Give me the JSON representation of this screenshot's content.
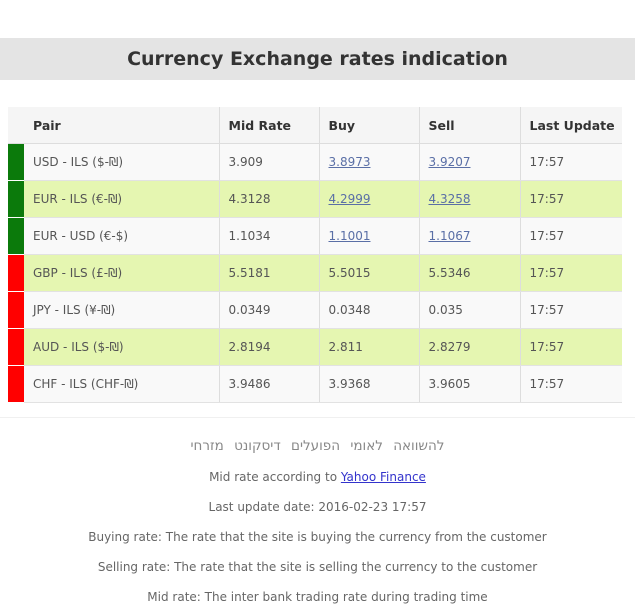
{
  "title": "Currency Exchange rates indication",
  "table": {
    "headers": [
      "Pair",
      "Mid Rate",
      "Buy",
      "Sell",
      "Last Update"
    ],
    "rows": [
      {
        "pair": "USD - ILS ($-₪)",
        "mid": "3.909",
        "buy": "3.8973",
        "sell": "3.9207",
        "time": "17:57",
        "trend": "up",
        "linked": true
      },
      {
        "pair": "EUR - ILS (€-₪)",
        "mid": "4.3128",
        "buy": "4.2999",
        "sell": "4.3258",
        "time": "17:57",
        "trend": "up",
        "linked": true
      },
      {
        "pair": "EUR - USD (€-$)",
        "mid": "1.1034",
        "buy": "1.1001",
        "sell": "1.1067",
        "time": "17:57",
        "trend": "up",
        "linked": true
      },
      {
        "pair": "GBP - ILS (£-₪)",
        "mid": "5.5181",
        "buy": "5.5015",
        "sell": "5.5346",
        "time": "17:57",
        "trend": "down",
        "linked": false
      },
      {
        "pair": "JPY - ILS (¥-₪)",
        "mid": "0.0349",
        "buy": "0.0348",
        "sell": "0.035",
        "time": "17:57",
        "trend": "down",
        "linked": false
      },
      {
        "pair": "AUD - ILS ($-₪)",
        "mid": "2.8194",
        "buy": "2.811",
        "sell": "2.8279",
        "time": "17:57",
        "trend": "down",
        "linked": false
      },
      {
        "pair": "CHF - ILS (CHF-₪)",
        "mid": "3.9486",
        "buy": "3.9368",
        "sell": "3.9605",
        "time": "17:57",
        "trend": "down",
        "linked": false
      }
    ]
  },
  "footer": {
    "banks": [
      "להשוואה",
      "לאומי",
      "הפועלים",
      "דיסקונט",
      "מזרחי"
    ],
    "mid_source_prefix": "Mid rate according to",
    "mid_source_link": "Yahoo Finance",
    "last_update": "Last update date: 2016-02-23 17:57",
    "buying_note": "Buying rate: The rate that the site is buying the currency from the customer",
    "selling_note": "Selling rate: The rate that the site is selling the currency to the customer",
    "mid_note": "Mid rate: The inter bank trading rate during trading time"
  },
  "colors": {
    "up": "#0b7a0b",
    "down": "#ff0000",
    "highlight_row": "#e5f6b1"
  }
}
